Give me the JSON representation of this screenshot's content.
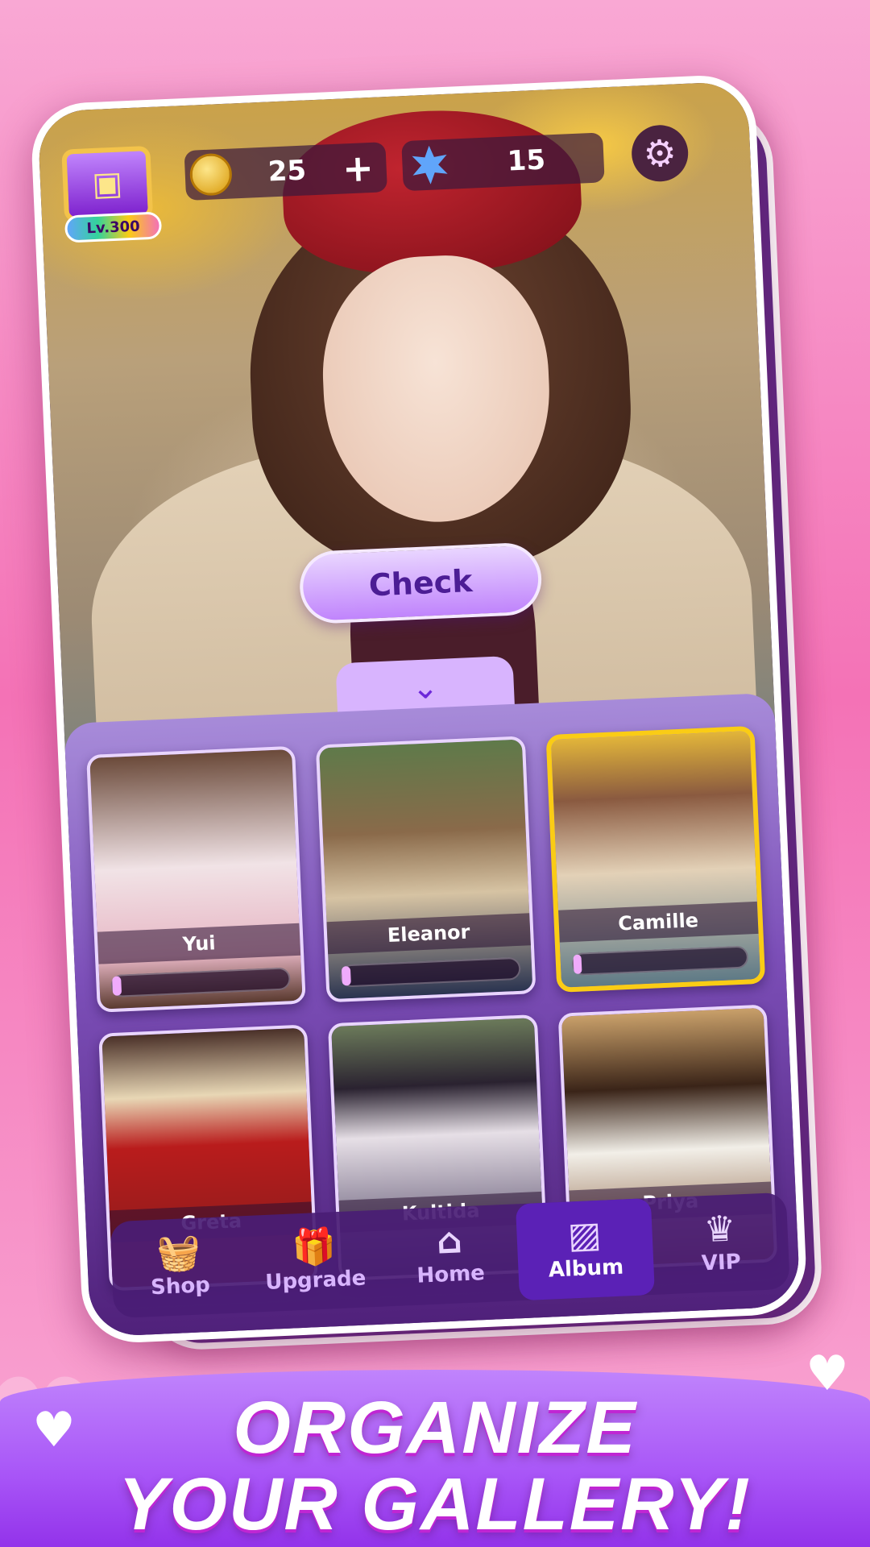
{
  "hud": {
    "level": "Lv.300",
    "coins": "25",
    "coins_plus": "+",
    "gems": "15"
  },
  "hero": {
    "check_label": "Check"
  },
  "album": {
    "cards": [
      {
        "name": "Yui",
        "progress": 0.05
      },
      {
        "name": "Eleanor",
        "progress": 0.05
      },
      {
        "name": "Camille",
        "progress": 0.05,
        "selected": true
      },
      {
        "name": "Greta"
      },
      {
        "name": "Kultida"
      },
      {
        "name": "Priya"
      }
    ]
  },
  "nav": {
    "items": [
      {
        "label": "Shop",
        "icon": "basket-icon"
      },
      {
        "label": "Upgrade",
        "icon": "gift-icon"
      },
      {
        "label": "Home",
        "icon": "home-icon"
      },
      {
        "label": "Album",
        "icon": "gallery-icon",
        "active": true
      },
      {
        "label": "VIP",
        "icon": "vip-crown-icon"
      }
    ]
  },
  "banner": {
    "line1": "ORGANIZE",
    "line2": "YOUR GALLERY!"
  },
  "colors": {
    "background_pink": "#f472b6",
    "panel_purple": "#7c4fb8",
    "selected_border": "#facc15",
    "accent": "#c084fc"
  }
}
